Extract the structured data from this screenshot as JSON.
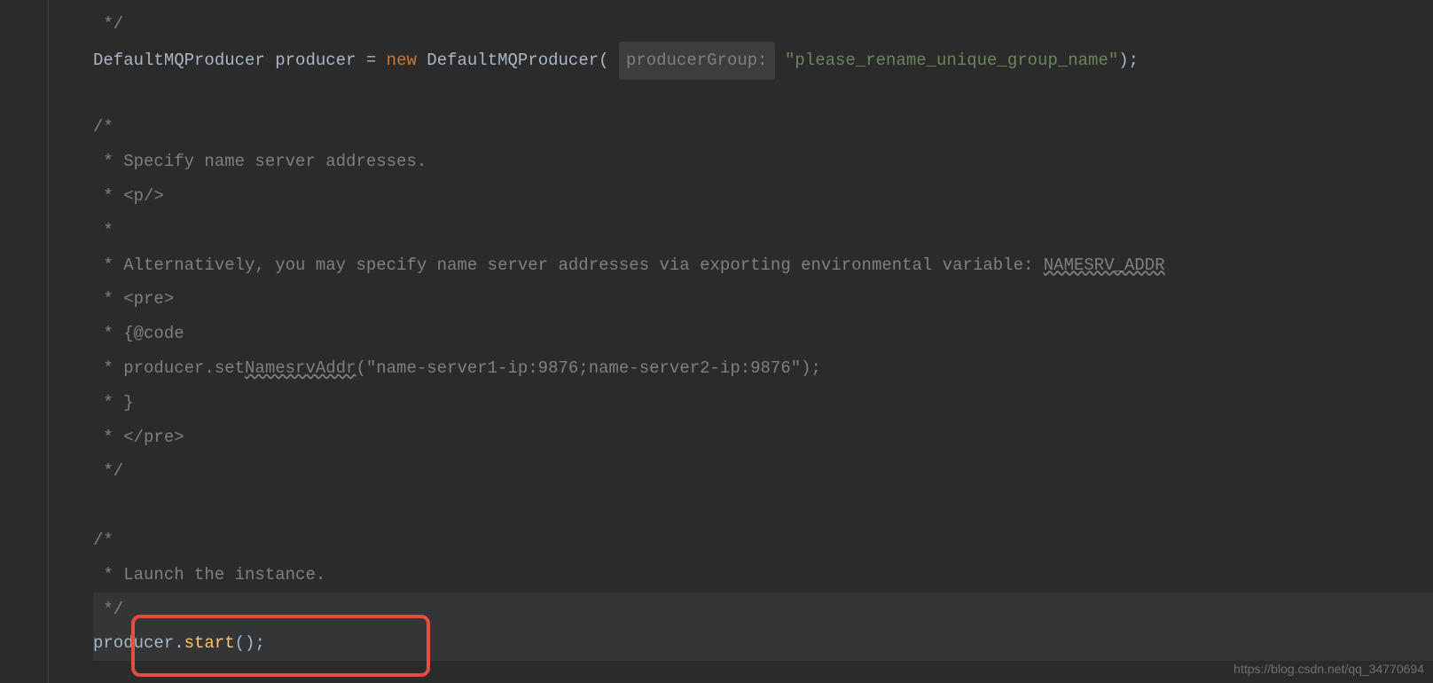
{
  "code": {
    "line1_comment_close": " */",
    "line2_class": "DefaultMQProducer",
    "line2_var": " producer ",
    "line2_eq": "=",
    "line2_new": " new ",
    "line2_ctor": "DefaultMQProducer",
    "line2_paren_open": "( ",
    "line2_hint": "producerGroup:",
    "line2_space": " ",
    "line2_string": "\"please_rename_unique_group_name\"",
    "line2_paren_close": ");",
    "line3_empty": "",
    "line4_c1": "/*",
    "line5_c2": " * Specify name server addresses.",
    "line6_c3": " * <p/>",
    "line7_c4": " *",
    "line8_c5_a": " * Alternatively, you may specify name server addresses via exporting environmental variable: ",
    "line8_c5_b": "NAMESRV_ADDR",
    "line9_c6": " * <pre>",
    "line10_c7": " * {@code",
    "line11_c8_a": " * producer.set",
    "line11_c8_b": "NamesrvAddr",
    "line11_c8_c": "(\"name-server1-ip:9876;name-server2-ip:9876\");",
    "line12_c9": " * }",
    "line13_c10": " * </pre>",
    "line14_c11": " */",
    "line15_empty": "",
    "line16_c12": "/*",
    "line17_c13": " * Launch the instance.",
    "line18_c14": " */",
    "line19_obj": "producer",
    "line19_dot": ".",
    "line19_method": "start",
    "line19_end": "();"
  },
  "watermark": "https://blog.csdn.net/qq_34770694"
}
